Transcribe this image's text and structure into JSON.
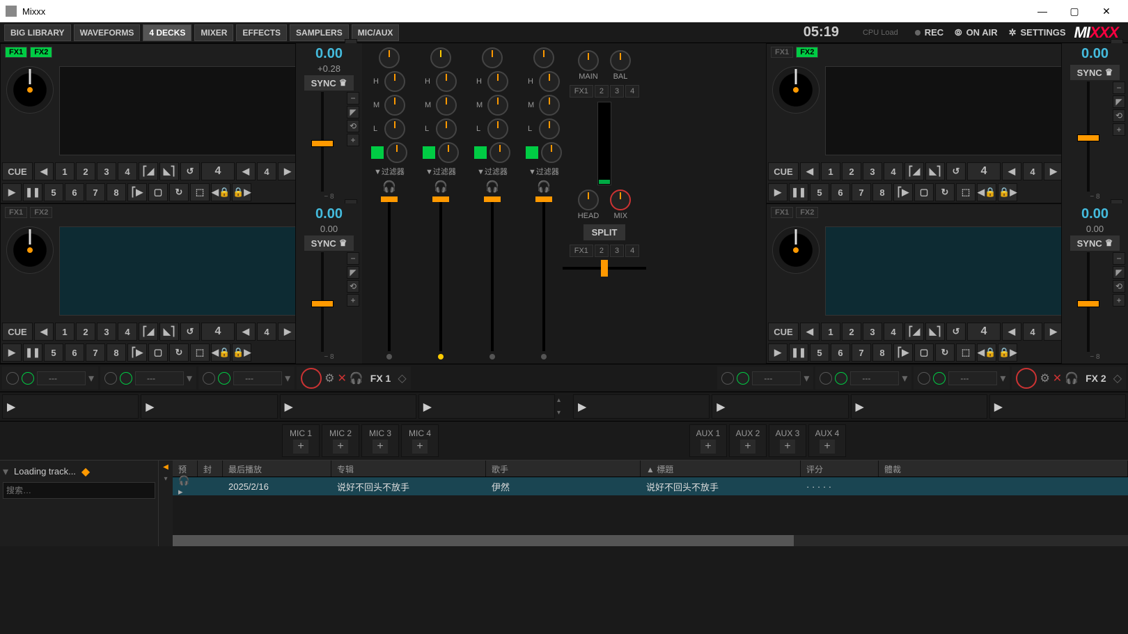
{
  "title": "Mixxx",
  "toolbar": {
    "big_library": "BIG LIBRARY",
    "waveforms": "WAVEFORMS",
    "four_decks": "4 DECKS",
    "mixer": "MIXER",
    "effects": "EFFECTS",
    "samplers": "SAMPLERS",
    "micaux": "MIC/AUX"
  },
  "clock": "05:19",
  "cpu": "CPU Load",
  "rec": "REC",
  "onair": "ON AIR",
  "settings": "SETTINGS",
  "logo1": "MI",
  "logo2": "XXX",
  "decks": [
    {
      "fx1": "FX1",
      "fx2": "FX2",
      "bpm": "0.00",
      "off": "+0.28",
      "sync": "SYNC",
      "cue": "CUE",
      "big": "4"
    },
    {
      "fx1": "FX1",
      "fx2": "FX2",
      "bpm": "0.00",
      "off": "0.00",
      "sync": "SYNC",
      "cue": "CUE",
      "big": "4"
    },
    {
      "fx1": "FX1",
      "fx2": "FX2",
      "bpm": "0.00",
      "off": "",
      "sync": "SYNC",
      "cue": "CUE",
      "big": "4"
    },
    {
      "fx1": "FX1",
      "fx2": "FX2",
      "bpm": "0.00",
      "off": "0.00",
      "sync": "SYNC",
      "cue": "CUE",
      "big": "4"
    }
  ],
  "hot": [
    "1",
    "2",
    "3",
    "4",
    "5",
    "6",
    "7",
    "8"
  ],
  "eq": {
    "h": "H",
    "m": "M",
    "l": "L"
  },
  "filter": "▼过滤器",
  "main": "MAIN",
  "bal": "BAL",
  "head": "HEAD",
  "mix": "MIX",
  "split": "SPLIT",
  "fxroute": [
    "FX1",
    "2",
    "3",
    "4"
  ],
  "fx_dashes": "---",
  "fx1": "FX 1",
  "fx2": "FX 2",
  "mic": [
    "MIC 1",
    "MIC 2",
    "MIC 3",
    "MIC 4"
  ],
  "aux": [
    "AUX 1",
    "AUX 2",
    "AUX 3",
    "AUX 4"
  ],
  "lib": {
    "loading": "Loading track...",
    "search": "搜索…",
    "cols": {
      "preview": "预览",
      "cover": "封面",
      "last": "最后播放",
      "album": "专辑",
      "artist": "歌手",
      "title": "▲ 標題",
      "rating": "评分",
      "genre": "體裁"
    },
    "row": {
      "date": "2025/2/16",
      "album": "说好不回头不放手",
      "artist": "伊然",
      "title": "说好不回头不放手",
      "rating": "·  ·  ·  ·  ·"
    }
  }
}
